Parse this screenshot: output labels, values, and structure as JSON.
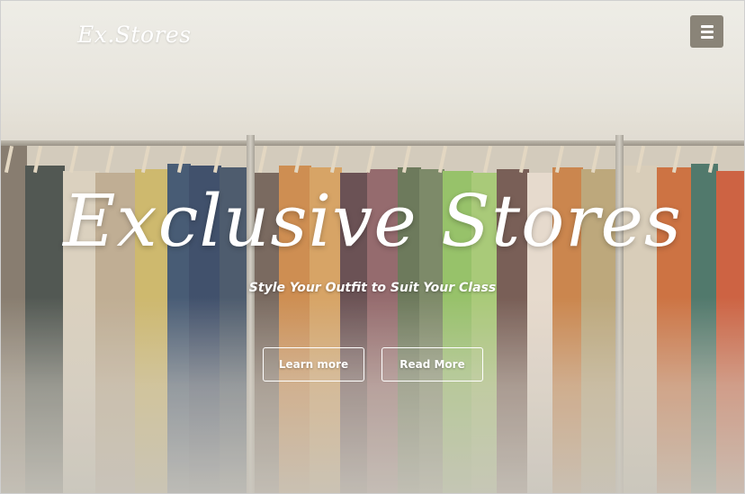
{
  "header": {
    "logo_text": "Ex.Stores",
    "menu_icon": "hamburger-menu-icon"
  },
  "hero": {
    "title": "Exclusive Stores",
    "subtitle": "Style Your Outfit to Suit Your Class",
    "buttons": {
      "learn_more": "Learn more",
      "read_more": "Read More"
    }
  },
  "colors": {
    "menu_button_bg": "#8a8478",
    "text": "#ffffff"
  }
}
